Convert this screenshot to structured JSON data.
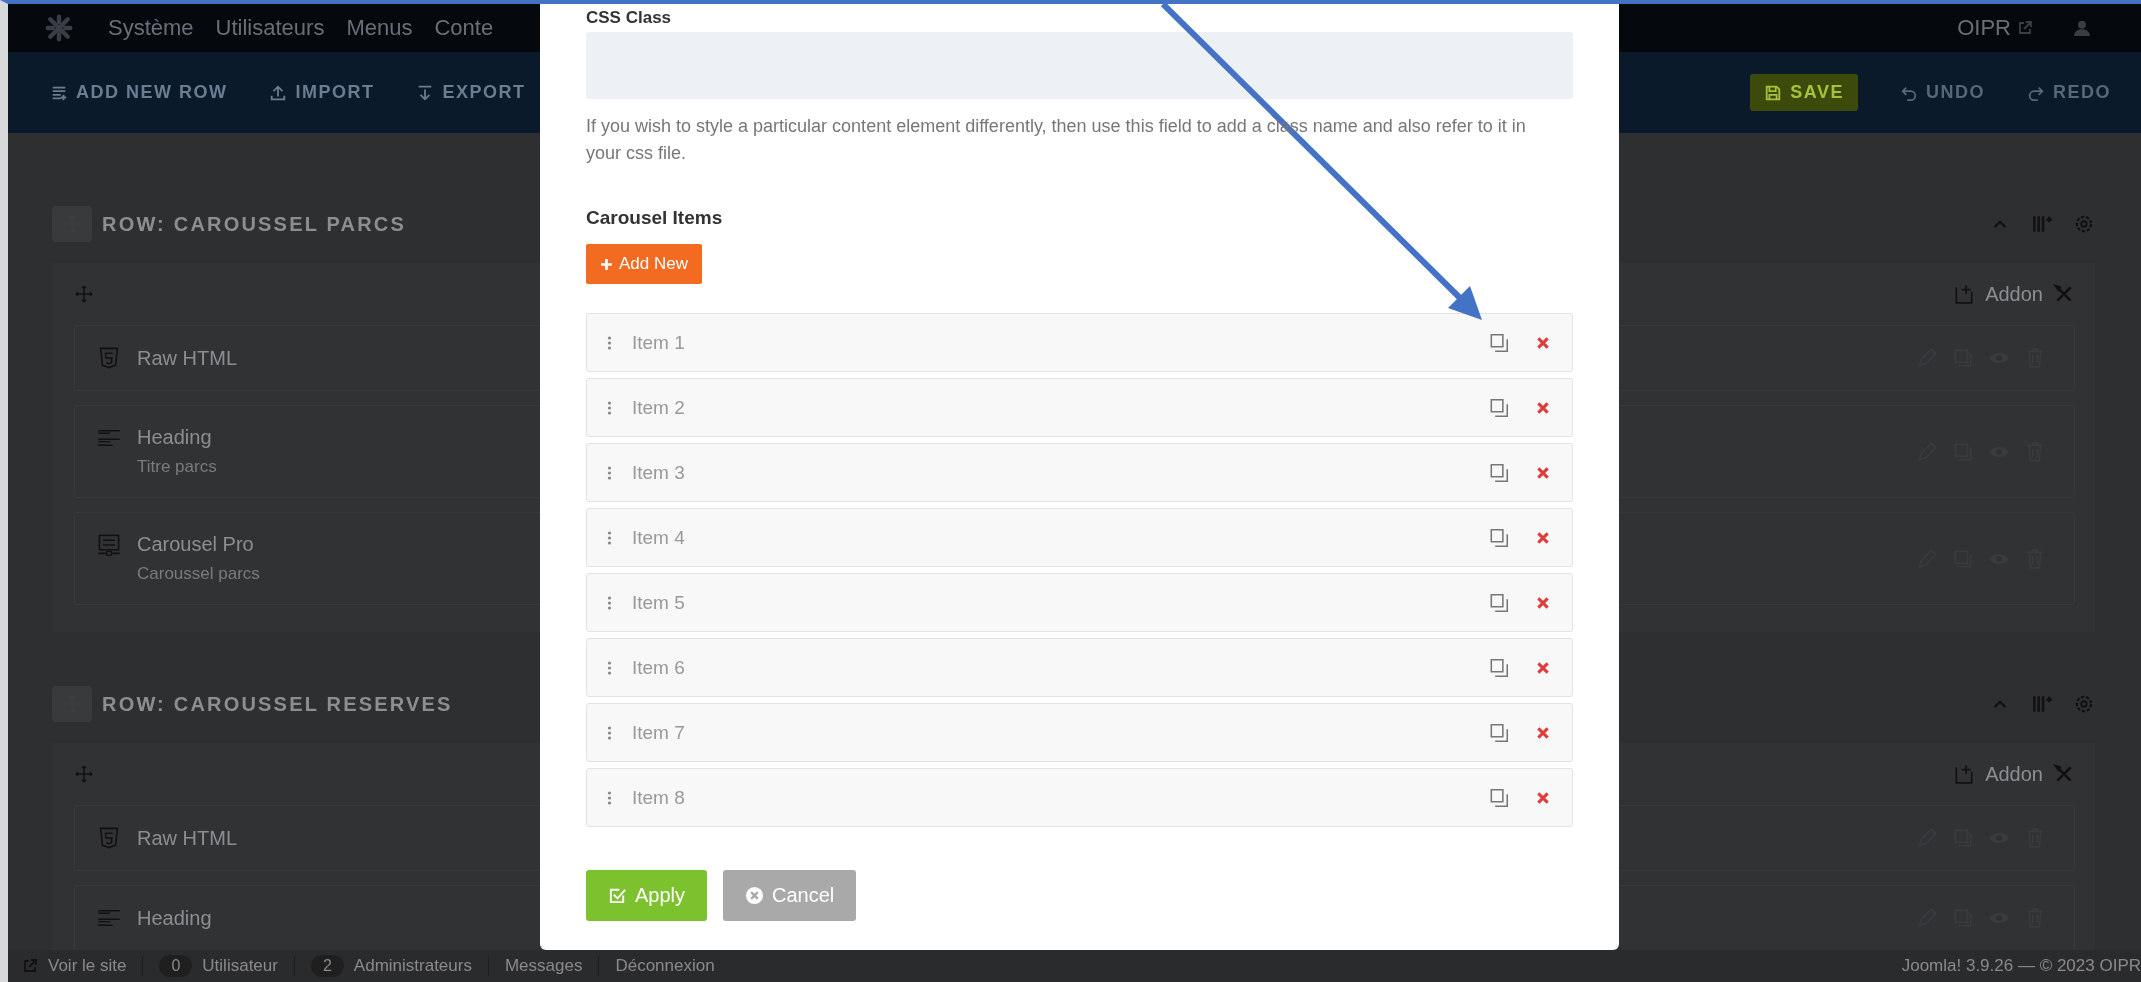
{
  "top_menu": {
    "items": [
      "Système",
      "Utilisateurs",
      "Menus",
      "Conte"
    ],
    "site_link": "OIPR"
  },
  "toolbar": {
    "left": [
      {
        "label": "ADD NEW ROW",
        "kind": "add-row"
      },
      {
        "label": "IMPORT",
        "kind": "import"
      },
      {
        "label": "EXPORT",
        "kind": "export"
      }
    ],
    "right": [
      {
        "label": "SAVE",
        "kind": "save",
        "disabled": false
      },
      {
        "label": "UNDO",
        "kind": "undo",
        "disabled": true
      },
      {
        "label": "REDO",
        "kind": "redo",
        "disabled": true
      }
    ]
  },
  "rows": [
    {
      "title": "ROW: CAROUSSEL PARCS",
      "addon_label": "Addon",
      "addons": [
        {
          "name": "Raw HTML",
          "kind": "html"
        },
        {
          "name": "Heading",
          "subtitle": "Titre parcs",
          "kind": "heading"
        },
        {
          "name": "Carousel Pro",
          "subtitle": "Caroussel parcs",
          "kind": "carousel"
        }
      ]
    },
    {
      "title": "ROW: CAROUSSEL RESERVES",
      "addon_label": "Addon",
      "addons": [
        {
          "name": "Raw HTML",
          "kind": "html"
        },
        {
          "name": "Heading",
          "kind": "heading"
        }
      ]
    }
  ],
  "modal": {
    "field_label": "CSS Class",
    "help": "If you wish to style a particular content element differently, then use this field to add a class name and also refer to it in your css file.",
    "section_title": "Carousel Items",
    "add_button": "Add New",
    "items": [
      {
        "label": "Item 1"
      },
      {
        "label": "Item 2"
      },
      {
        "label": "Item 3"
      },
      {
        "label": "Item 4"
      },
      {
        "label": "Item 5"
      },
      {
        "label": "Item 6"
      },
      {
        "label": "Item 7"
      },
      {
        "label": "Item 8"
      }
    ],
    "apply": "Apply",
    "cancel": "Cancel"
  },
  "status_bar": {
    "view_site": "Voir le site",
    "badges": [
      {
        "count": "0",
        "label": "Utilisateur"
      },
      {
        "count": "2",
        "label": "Administrateurs"
      },
      {
        "label": "Messages"
      }
    ],
    "logout": "Déconnexion",
    "version": "Joomla! 3.9.26  —  © 2023 OIPR"
  }
}
